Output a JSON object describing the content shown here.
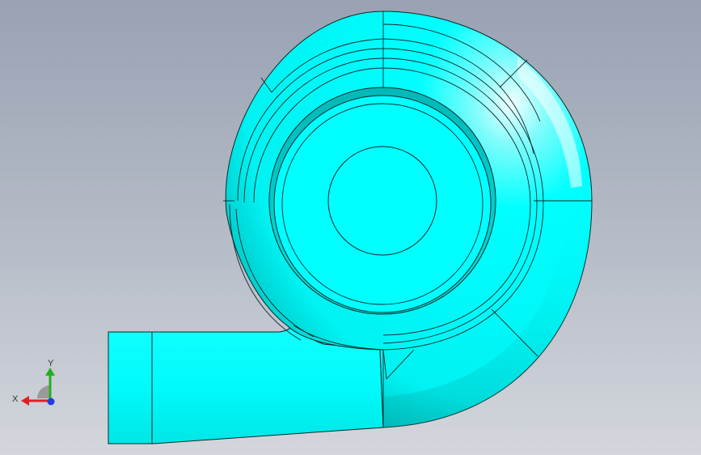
{
  "viewport": {
    "background_top": "#98a2b3",
    "background_bottom": "#d3d6dc"
  },
  "model": {
    "icon": "pump-volute-model",
    "surface_color": "#00ffff",
    "edge_color": "#0a2a2a"
  },
  "triad": {
    "x_label": "X",
    "y_label": "Y",
    "x_color": "#e02020",
    "y_color": "#20b020",
    "z_color": "#2040e0"
  }
}
